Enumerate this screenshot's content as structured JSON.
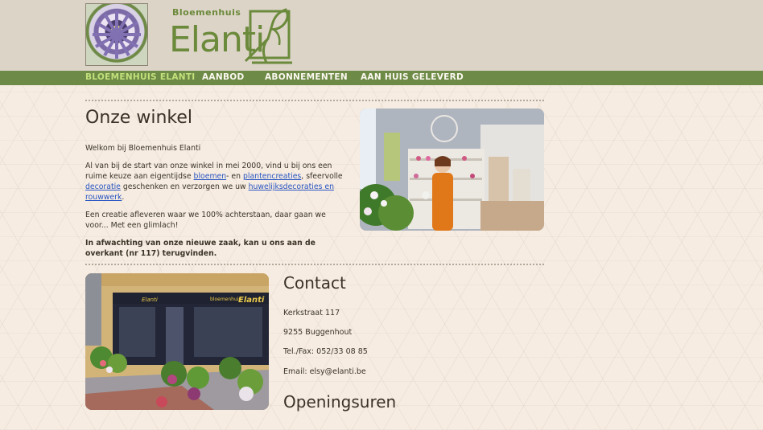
{
  "brand": {
    "small": "Bloemenhuis",
    "big": "Elanti"
  },
  "nav": {
    "items": [
      {
        "label": "BLOEMENHUIS ELANTI",
        "active": true
      },
      {
        "label": "AANBOD",
        "active": false
      },
      {
        "label": "ABONNEMENTEN",
        "active": false
      },
      {
        "label": "AAN HUIS GELEVERD",
        "active": false
      }
    ]
  },
  "main": {
    "title": "Onze winkel",
    "welcome": "Welkom bij Bloemenhuis Elanti",
    "para1": {
      "t1": "Al van bij de start van onze winkel in mei 2000, vind u bij ons een ruime keuze aan eigentijdse ",
      "link1": "bloemen",
      "t2": "- en ",
      "link2": "plantencreaties",
      "t3": ", sfeervolle ",
      "link3": "decoratie",
      "t4": " geschenken en verzorgen we uw ",
      "link4": "huwelijksdecoraties en rouwwerk",
      "t5": "."
    },
    "para2": "Een creatie afleveren waar we 100% achterstaan, daar gaan we voor... Met een glimlach!",
    "notice": "In afwachting van onze nieuwe zaak, kan u ons aan de overkant (nr 117) terugvinden."
  },
  "contact": {
    "title": "Contact",
    "street": "Kerkstraat 117",
    "city": "9255 Buggenhout",
    "phone": "Tel./Fax: 052/33 08 85",
    "email": "Email: elsy@elanti.be"
  },
  "hours": {
    "title": "Openingsuren"
  },
  "storefront_sign": {
    "small": "bloemenhuis",
    "big": "Elanti"
  },
  "colors": {
    "accent_green": "#6d8a46",
    "active_nav": "#c3e07c",
    "link": "#2855c2",
    "header_bg": "#ddd4c8",
    "page_bg": "#f6ece2"
  }
}
